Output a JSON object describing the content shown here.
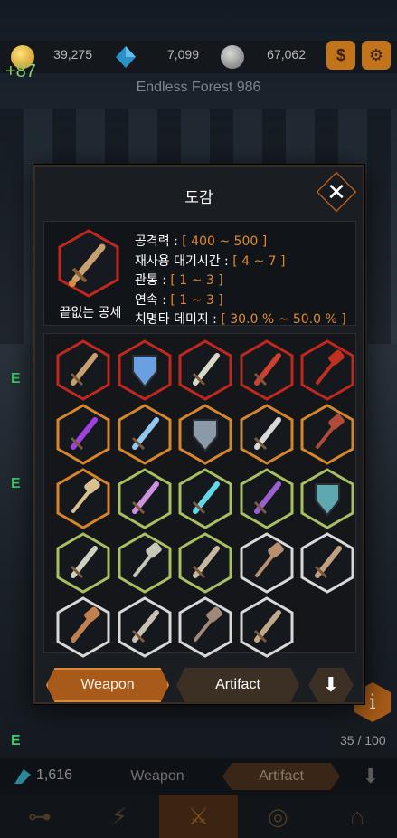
{
  "resources": {
    "gold": "39,275",
    "gems": "7,099",
    "stones": "67,062",
    "gold_gain": "+87"
  },
  "stage": "Endless Forest 986",
  "bottom": {
    "gem_count": "1,616",
    "weapon_tab": "Weapon",
    "artifact_tab": "Artifact",
    "collection_count": "35 / 100"
  },
  "modal": {
    "title": "도감",
    "selected": {
      "name": "끝없는 공세",
      "tier": "red",
      "stats": [
        {
          "label": "공격력 : ",
          "value": "[ 400 ~ 500 ]"
        },
        {
          "label": "재사용 대기시간 : ",
          "value": "[ 4 ~ 7 ]"
        },
        {
          "label": "관통 : ",
          "value": "[ 1 ~ 3 ]"
        },
        {
          "label": "연속 : ",
          "value": "[ 1 ~ 3 ]"
        },
        {
          "label": "치명타 데미지 : ",
          "value": "[ 30.0 % ~ 50.0 % ]"
        }
      ]
    },
    "tabs": {
      "weapon": "Weapon",
      "artifact": "Artifact"
    }
  },
  "tier_colors": {
    "red": "#c0281e",
    "orange": "#d6862a",
    "green": "#a8c060",
    "white": "#d8d8d8"
  },
  "weapons": [
    {
      "tier": "red",
      "icon": "greatsword-icon",
      "color": "#c8a070"
    },
    {
      "tier": "red",
      "icon": "shield-icon",
      "color": "#6aa0e0"
    },
    {
      "tier": "red",
      "icon": "sword-icon",
      "color": "#d8d8c8"
    },
    {
      "tier": "red",
      "icon": "flame-sword-icon",
      "color": "#d04030"
    },
    {
      "tier": "red",
      "icon": "battle-axe-icon",
      "color": "#c03020"
    },
    {
      "tier": "orange",
      "icon": "magic-blade-icon",
      "color": "#a040e0"
    },
    {
      "tier": "orange",
      "icon": "ice-sword-icon",
      "color": "#90c8f0"
    },
    {
      "tier": "orange",
      "icon": "armor-shield-icon",
      "color": "#8a9aa8"
    },
    {
      "tier": "orange",
      "icon": "curved-sword-icon",
      "color": "#d8d8d8"
    },
    {
      "tier": "orange",
      "icon": "spiked-axe-icon",
      "color": "#b04a3a"
    },
    {
      "tier": "orange",
      "icon": "hammer-icon",
      "color": "#d8c090"
    },
    {
      "tier": "green",
      "icon": "scimitar-icon",
      "color": "#d090e0"
    },
    {
      "tier": "green",
      "icon": "crystal-saber-icon",
      "color": "#60d8e8"
    },
    {
      "tier": "green",
      "icon": "dagger-icon",
      "color": "#9a60d0"
    },
    {
      "tier": "green",
      "icon": "teal-shield-icon",
      "color": "#60a8b0"
    },
    {
      "tier": "green",
      "icon": "short-sword-icon",
      "color": "#d0d0c0"
    },
    {
      "tier": "green",
      "icon": "axe-icon",
      "color": "#c8c8b8"
    },
    {
      "tier": "green",
      "icon": "knife-icon",
      "color": "#c8b8a0"
    },
    {
      "tier": "white",
      "icon": "war-hammer-icon",
      "color": "#b89070"
    },
    {
      "tier": "white",
      "icon": "machete-icon",
      "color": "#c0a080"
    },
    {
      "tier": "white",
      "icon": "club-icon",
      "color": "#c08050"
    },
    {
      "tier": "white",
      "icon": "rapier-icon",
      "color": "#c8c0b0"
    },
    {
      "tier": "white",
      "icon": "double-axe-icon",
      "color": "#a08878"
    },
    {
      "tier": "white",
      "icon": "shiv-icon",
      "color": "#c0a888"
    }
  ]
}
